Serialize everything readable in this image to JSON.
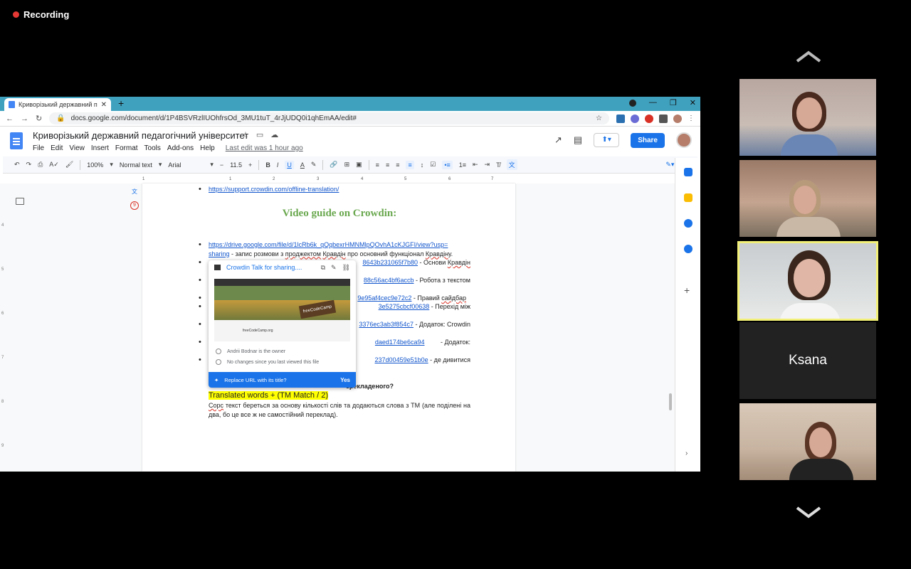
{
  "recording": {
    "label": "Recording"
  },
  "browser": {
    "tab_title": "Криворізький державний педаг",
    "new_tab": "+",
    "url": "docs.google.com/document/d/1P4BSVRzlIUOhfrsOd_3MU1tuT_4rJjUDQ0i1qhEmAA/edit#"
  },
  "doc": {
    "title": "Криворізький державний педагогічний університет",
    "menus": [
      "File",
      "Edit",
      "View",
      "Insert",
      "Format",
      "Tools",
      "Add-ons",
      "Help"
    ],
    "last_edit": "Last edit was 1 hour ago",
    "share": "Share",
    "toolbar": {
      "zoom": "100%",
      "style": "Normal text",
      "font": "Arial",
      "size": "11.5"
    },
    "comments_count": "9",
    "body": {
      "link_top": "https://support.crowdin.com/offline-translation/",
      "heading": "Video guide on Crowdin:",
      "l1a": "https://drive.google.com/file/d/1lcRb6k_qQqbexrHMNMlpQOvhA1cKJGFI/view?usp=",
      "l1b": "sharing",
      "l1c": " - запис розмови з ",
      "l1d": "проджектом",
      "l1e": " ",
      "l1f": "Кравдін",
      "l1g": " про основний функціонал ",
      "l1h": "Кравдіну",
      "l1i": ".",
      "l2a": "8643b231065f7b80",
      "l2b": " - Основи ",
      "l2c": "Кравдін",
      "l3a": "88c56ac4bf6accb",
      "l3b": " - Робота з текстом",
      "l4a": "9e95af4cec9e72c2",
      "l4b": " - Правий ",
      "l4c": "сайдбар",
      "l5a": "3e5275cbcf00638",
      "l5b": " - Перехід між",
      "l6a": "3376ec3ab3f854c7",
      "l6b": " - Додаток: Crowdin",
      "l7a": "daed174be6ca94",
      "l7b": " - Додаток:",
      "l8a": "237d00459e51b0e",
      "l8b": " - де дивитися",
      "q_tail": "ерекладеного?",
      "highlight": "Translated words + (TM Match / 2)",
      "p1a": "Сорс",
      "p1b": " текст береться за основу кількості слів та додаються слова з ТМ (але поділені на два, бо це все ж не самостійний переклад)."
    },
    "popup": {
      "title": "Crowdin Talk for sharing....",
      "owner": "Andrii Bodnar is the owner",
      "changes": "No changes since you last viewed this file",
      "replace": "Replace URL with its title?",
      "yes": "Yes",
      "thumb_sign": "freeCodeCamp",
      "thumb_site": "freeCodeCamp.org"
    },
    "ruler": [
      "1",
      "1",
      "2",
      "3",
      "4",
      "5",
      "6",
      "7"
    ],
    "vruler": [
      "4",
      "5",
      "6",
      "7",
      "8",
      "9"
    ]
  },
  "participants": [
    {
      "name": ""
    },
    {
      "name": ""
    },
    {
      "name": ""
    },
    {
      "name": "Ksana"
    },
    {
      "name": ""
    }
  ],
  "colors": {
    "accent": "#1a73e8",
    "heading": "#6aa84f",
    "highlight": "#ffff00",
    "speaker_border": "#f2f078"
  }
}
